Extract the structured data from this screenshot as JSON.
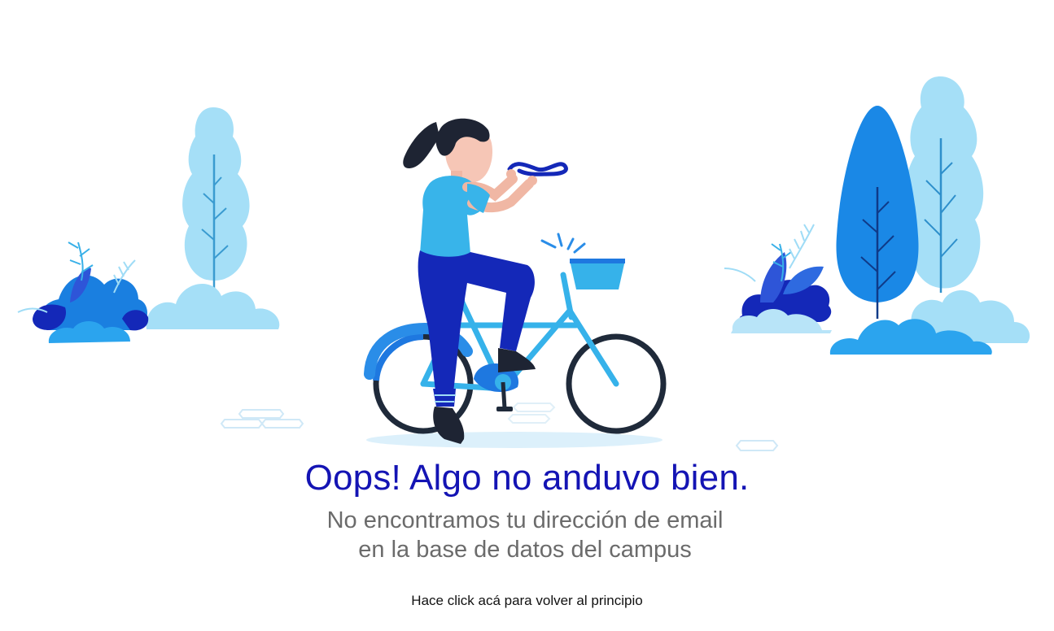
{
  "message": {
    "title": "Oops! Algo no anduvo bien.",
    "line1": "No encontramos tu dirección de email",
    "line2": "en la base de datos del campus",
    "back_link": "Hace click acá para volver al principio"
  },
  "colors": {
    "title": "#1414b4",
    "subtitle": "#6b6b6b",
    "light_blue": "#9fdcf6",
    "mid_blue": "#2a9ee8",
    "deep_blue": "#1528b8"
  },
  "illustration": {
    "icon": "woman-on-bicycle-with-broken-handlebar-illustration"
  }
}
